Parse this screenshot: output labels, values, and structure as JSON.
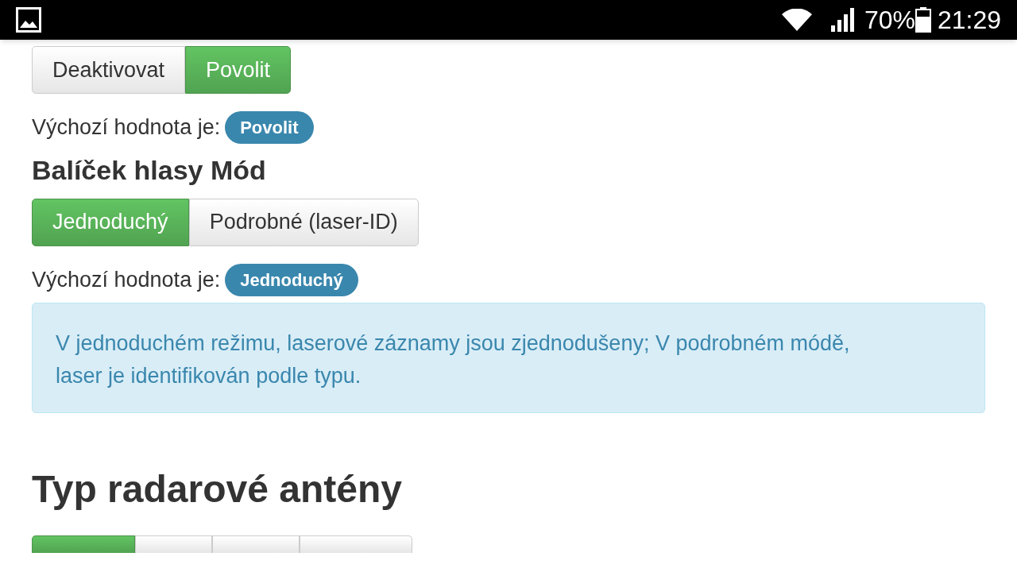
{
  "status_bar": {
    "battery_percent": "70%",
    "time": "21:29"
  },
  "sections": [
    {
      "kind": "toggle",
      "options": [
        {
          "label": "Deaktivovat",
          "selected": false
        },
        {
          "label": "Povolit",
          "selected": true
        }
      ],
      "default_label": "Výchozí hodnota je:",
      "default_value": "Povolit"
    },
    {
      "kind": "toggle",
      "heading": "Balíček hlasy Mód",
      "options": [
        {
          "label": "Jednoduchý",
          "selected": true
        },
        {
          "label": "Podrobné (laser-ID)",
          "selected": false
        }
      ],
      "default_label": "Výchozí hodnota je:",
      "default_value": "Jednoduchý"
    },
    {
      "kind": "info",
      "text": "V jednoduchém režimu, laserové záznamy jsou zjednodušeny; V podrobném módě, laser je identifikován podle typu."
    },
    {
      "kind": "cutoff",
      "heading": "Typ radarové antény",
      "options": [
        {
          "selected": true
        },
        {
          "selected": false
        },
        {
          "selected": false
        },
        {
          "selected": false
        }
      ]
    }
  ]
}
